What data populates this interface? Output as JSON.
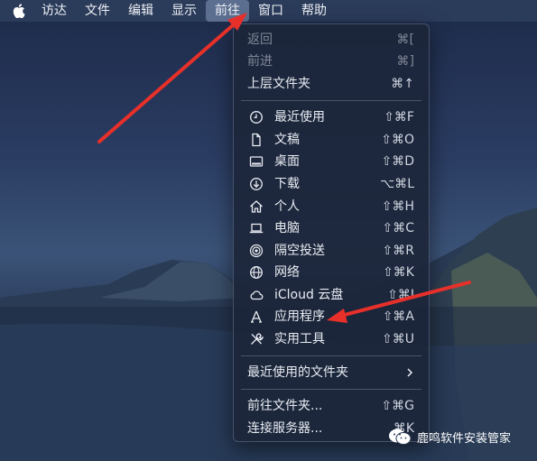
{
  "menubar": {
    "items": [
      "访达",
      "文件",
      "编辑",
      "显示",
      "前往",
      "窗口",
      "帮助"
    ],
    "active_index": 4
  },
  "go_menu": {
    "back": {
      "label": "返回",
      "shortcut": "⌘["
    },
    "forward": {
      "label": "前进",
      "shortcut": "⌘]"
    },
    "enclosing": {
      "label": "上层文件夹",
      "shortcut": "⌘↑"
    },
    "items": [
      {
        "label": "最近使用",
        "shortcut": "⇧⌘F",
        "icon": "clock-icon"
      },
      {
        "label": "文稿",
        "shortcut": "⇧⌘O",
        "icon": "document-icon"
      },
      {
        "label": "桌面",
        "shortcut": "⇧⌘D",
        "icon": "desktop-icon"
      },
      {
        "label": "下载",
        "shortcut": "⌥⌘L",
        "icon": "download-icon"
      },
      {
        "label": "个人",
        "shortcut": "⇧⌘H",
        "icon": "home-icon"
      },
      {
        "label": "电脑",
        "shortcut": "⇧⌘C",
        "icon": "laptop-icon"
      },
      {
        "label": "隔空投送",
        "shortcut": "⇧⌘R",
        "icon": "airdrop-icon"
      },
      {
        "label": "网络",
        "shortcut": "⇧⌘K",
        "icon": "globe-icon"
      },
      {
        "label": "iCloud 云盘",
        "shortcut": "⇧⌘I",
        "icon": "cloud-icon"
      },
      {
        "label": "应用程序",
        "shortcut": "⇧⌘A",
        "icon": "applications-icon"
      },
      {
        "label": "实用工具",
        "shortcut": "⇧⌘U",
        "icon": "utilities-icon"
      }
    ],
    "recent_folders": {
      "label": "最近使用的文件夹"
    },
    "goto_folder": {
      "label": "前往文件夹...",
      "shortcut": "⇧⌘G"
    },
    "connect_server": {
      "label": "连接服务器...",
      "shortcut": "⌘K"
    }
  },
  "watermark": {
    "text": "鹿鸣软件安装管家"
  },
  "colors": {
    "arrow": "#e8302a",
    "menu_bg": "#1c263a",
    "active_menubar": "#5d6f91"
  }
}
